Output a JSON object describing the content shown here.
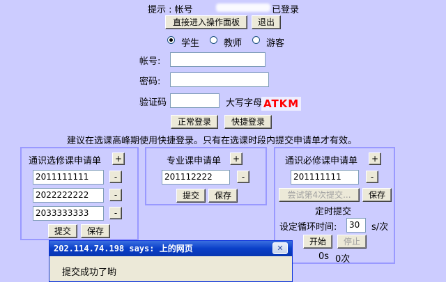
{
  "header": {
    "tip_label": "提示 : 帐号",
    "logged_in_text": "已登录",
    "enter_panel_label": "直接进入操作面板",
    "logout_label": "退出"
  },
  "login": {
    "roles": [
      "学生",
      "教师",
      "游客"
    ],
    "selected_role": "学生",
    "account_label": "帐号:",
    "password_label": "密码:",
    "captcha_label": "验证码",
    "captcha_hint": "大写字母",
    "captcha_value": "ATKM",
    "normal_login_label": "正常登录",
    "quick_login_label": "快捷登录",
    "advice": "建议在选课高峰期使用快捷登录。只有在选课时段内提交申请单才有效。"
  },
  "panels": {
    "general_elective": {
      "title": "通识选修课申请单",
      "add_label": "+",
      "remove_label": "-",
      "entries": [
        "2011111111",
        "2022222222",
        "2033333333"
      ],
      "submit_label": "提交",
      "save_label": "保存"
    },
    "major": {
      "title": "专业课申请单",
      "add_label": "+",
      "remove_label": "-",
      "entries": [
        "201112222"
      ],
      "submit_label": "提交",
      "save_label": "保存"
    },
    "general_required": {
      "title": "通识必修课申请单",
      "add_label": "+",
      "remove_label": "-",
      "entries": [
        "201111111"
      ],
      "try_submit_label": "尝试第4次提交...",
      "save_label": "保存",
      "timer_title": "定时提交",
      "interval_label": "设定循环时间:",
      "interval_value": "30",
      "interval_unit": "s/次",
      "start_label": "开始",
      "stop_label": "停止",
      "elapsed": "0s",
      "count": "0次"
    }
  },
  "dialog": {
    "title": "202.114.74.198 says: 上的网页",
    "close_label": "✕",
    "message": "提交成功了哟"
  }
}
